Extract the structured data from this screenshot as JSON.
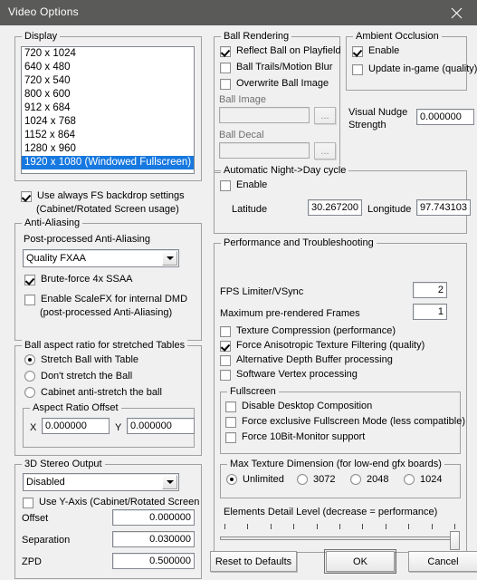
{
  "window": {
    "title": "Video Options",
    "close_icon": "close-icon"
  },
  "display": {
    "legend": "Display",
    "resolutions": [
      "720 x 1024",
      "640 x 480",
      "720 x 540",
      "800 x 600",
      "912 x 684",
      "1024 x 768",
      "1152 x 864",
      "1280 x 960",
      "1920 x 1080 (Windowed Fullscreen)"
    ],
    "selected_index": 8,
    "fs_backdrop": {
      "label": "Use always FS backdrop settings",
      "sublabel": "(Cabinet/Rotated Screen usage)",
      "checked": true
    }
  },
  "antialiasing": {
    "legend": "Anti-Aliasing",
    "post_label": "Post-processed Anti-Aliasing",
    "post_value": "Quality FXAA",
    "brute_force": {
      "label": "Brute-force 4x SSAA",
      "checked": true
    },
    "scalefx": {
      "label": "Enable ScaleFX for internal DMD",
      "sublabel": "(post-processed Anti-Aliasing)",
      "checked": false
    }
  },
  "ball_aspect": {
    "legend": "Ball aspect ratio for stretched Tables",
    "options": [
      "Stretch Ball with Table",
      "Don't stretch the Ball",
      "Cabinet anti-stretch the ball"
    ],
    "selected_index": 0,
    "offset": {
      "legend": "Aspect Ratio Offset",
      "x_label": "X",
      "x_value": "0.000000",
      "y_label": "Y",
      "y_value": "0.000000"
    }
  },
  "stereo": {
    "legend": "3D Stereo Output",
    "mode": "Disabled",
    "y_axis": {
      "label": "Use Y-Axis (Cabinet/Rotated Screen",
      "checked": false
    },
    "fields": [
      {
        "label": "Offset",
        "value": "0.000000"
      },
      {
        "label": "Separation",
        "value": "0.030000"
      },
      {
        "label": "ZPD",
        "value": "0.500000"
      }
    ]
  },
  "ball_rendering": {
    "legend": "Ball Rendering",
    "reflect": {
      "label": "Reflect Ball on Playfield",
      "checked": true
    },
    "trails": {
      "label": "Ball Trails/Motion Blur",
      "checked": false
    },
    "overwrite": {
      "label": "Overwrite Ball Image",
      "checked": false
    },
    "ball_image_label": "Ball Image",
    "ball_image_value": "",
    "ball_decal_label": "Ball Decal",
    "ball_decal_value": "",
    "browse_label": "..."
  },
  "ambient_occlusion": {
    "legend": "Ambient Occlusion",
    "enable": {
      "label": "Enable",
      "checked": true
    },
    "update": {
      "label": "Update in-game (quality)",
      "checked": false
    }
  },
  "visual_nudge": {
    "label_line1": "Visual Nudge",
    "label_line2": "Strength",
    "value": "0.000000"
  },
  "night_day": {
    "legend": "Automatic Night->Day cycle",
    "enable": {
      "label": "Enable",
      "checked": false
    },
    "latitude_label": "Latitude",
    "latitude_value": "30.267200",
    "longitude_label": "Longitude",
    "longitude_value": "97.743103"
  },
  "performance": {
    "legend": "Performance and Troubleshooting",
    "fps_label": "FPS Limiter/VSync",
    "fps_value": "2",
    "prerender_label": "Maximum pre-rendered Frames",
    "prerender_value": "1",
    "checks": [
      {
        "label": "Texture Compression (performance)",
        "checked": false
      },
      {
        "label": "Force Anisotropic Texture Filtering (quality)",
        "checked": true
      },
      {
        "label": "Alternative Depth Buffer processing",
        "checked": false
      },
      {
        "label": "Software Vertex processing",
        "checked": false
      }
    ],
    "fullscreen": {
      "legend": "Fullscreen",
      "checks": [
        {
          "label": "Disable Desktop Composition",
          "checked": false
        },
        {
          "label": "Force exclusive Fullscreen Mode (less compatible)",
          "checked": false
        },
        {
          "label": "Force 10Bit-Monitor support",
          "checked": false
        }
      ]
    },
    "max_texture": {
      "legend": "Max Texture Dimension (for low-end gfx boards)",
      "options": [
        "Unlimited",
        "3072",
        "2048",
        "1024"
      ],
      "selected_index": 0
    },
    "detail": {
      "label": "Elements Detail Level (decrease = performance)",
      "ticks": 11,
      "value": 10,
      "max": 10
    }
  },
  "footer": {
    "reset_label": "Reset to Defaults",
    "ok_label": "OK",
    "cancel_label": "Cancel"
  },
  "colors": {
    "titlebar": "#5a5a58",
    "selection": "#1678e0",
    "face": "#f0f0f0"
  }
}
